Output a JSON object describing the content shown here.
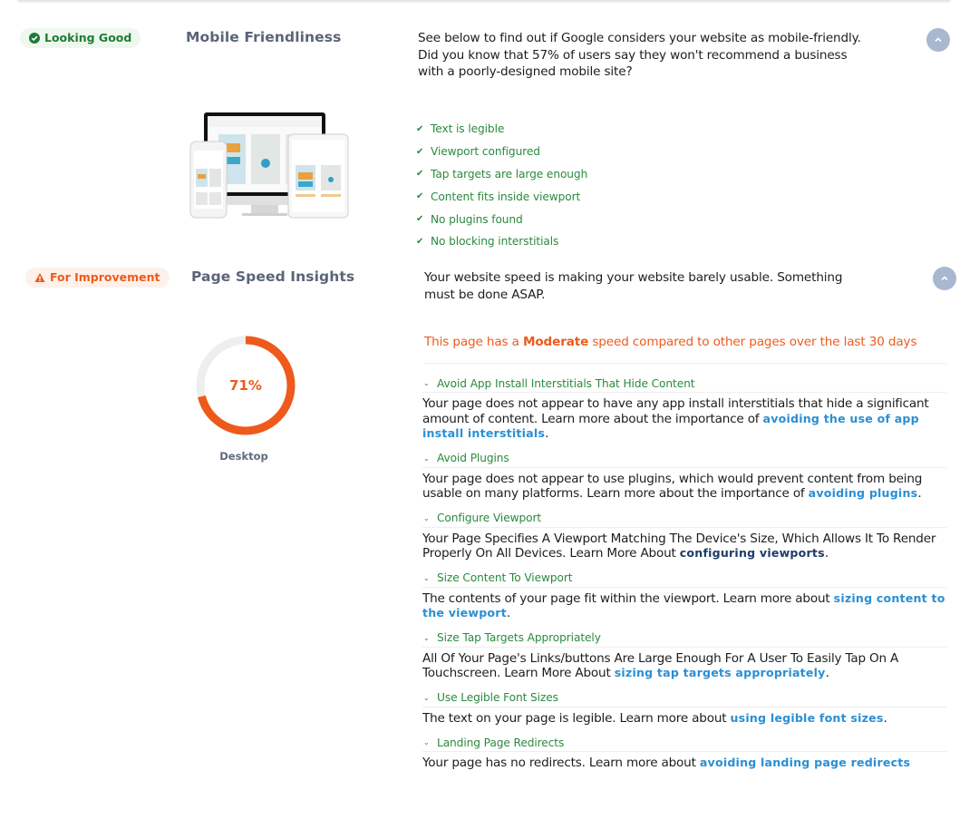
{
  "mobile": {
    "badge": "Looking Good",
    "badge_icon": "check-circle-icon",
    "title": "Mobile Friendliness",
    "description": "See below to find out if Google considers your website as mobile-friendly. Did you know that 57% of users say they won't recommend a business with a poorly-designed mobile site?",
    "collapse_icon": "chevron-up-icon",
    "image_alt": "devices-preview",
    "checks": [
      "Text is legible",
      "Viewport configured",
      "Tap targets are large enough",
      "Content fits inside viewport",
      "No plugins found",
      "No blocking interstitials"
    ]
  },
  "speed": {
    "badge": "For Improvement",
    "badge_icon": "warning-triangle-icon",
    "title": "Page Speed Insights",
    "description": "Your website speed is making your website barely usable. Something must be done ASAP.",
    "collapse_icon": "chevron-up-icon",
    "score_label": "71%",
    "score_value": 71,
    "device_label": "Desktop",
    "speed_prefix": "This page has a ",
    "speed_rating": "Moderate",
    "speed_suffix": " speed compared to other pages over the last 30 days",
    "colors": {
      "good": "#2b8a3e",
      "warn": "#ee5a1b",
      "link": "#2a8fd4",
      "gauge_track": "#eeeeee"
    },
    "items": [
      {
        "title": "Avoid App Install Interstitials That Hide Content",
        "text": "Your page does not appear to have any app install interstitials that hide a significant amount of content. Learn more about the importance of ",
        "link": "avoiding the use of app install interstitials",
        "after": "."
      },
      {
        "title": "Avoid Plugins",
        "text": "Your page does not appear to use plugins, which would prevent content from being usable on many platforms. Learn more about the importance of ",
        "link": "avoiding plugins",
        "after": "."
      },
      {
        "title": "Configure Viewport",
        "text": "Your Page Specifies A Viewport Matching The Device's Size, Which Allows It To Render Properly On All Devices. Learn More About ",
        "link": "configuring viewports",
        "after": "."
      },
      {
        "title": "Size Content To Viewport",
        "text": "The contents of your page fit within the viewport. Learn more about ",
        "link": "sizing content to the viewport",
        "after": "."
      },
      {
        "title": "Size Tap Targets Appropriately",
        "text": "All Of Your Page's Links/buttons Are Large Enough For A User To Easily Tap On A Touchscreen. Learn More About ",
        "link": "sizing tap targets appropriately",
        "after": "."
      },
      {
        "title": "Use Legible Font Sizes",
        "text": "The text on your page is legible. Learn more about ",
        "link": "using legible font sizes",
        "after": "."
      },
      {
        "title": "Landing Page Redirects",
        "text": "Your page has no redirects. Learn more about ",
        "link": "avoiding landing page redirects",
        "after": ""
      }
    ]
  }
}
